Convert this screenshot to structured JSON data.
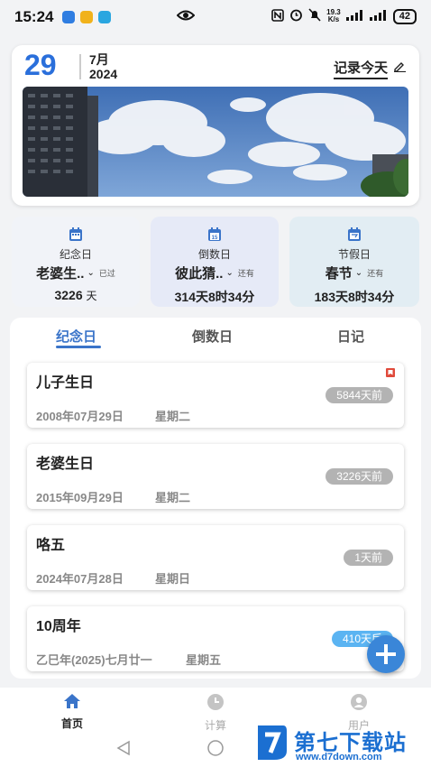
{
  "status_bar": {
    "time": "15:24",
    "net_speed_value": "19.3",
    "net_speed_unit": "K/s",
    "battery": "42"
  },
  "header": {
    "day": "29",
    "month": "7月",
    "year": "2024",
    "record_label": "记录今天"
  },
  "stats": [
    {
      "type": "纪念日",
      "name": "老婆生..",
      "suffix": "已过",
      "value": "3226",
      "unit": "天",
      "value_text": null
    },
    {
      "type": "倒数日",
      "name": "彼此猜..",
      "suffix": "还有",
      "value_text": "314天8时34分"
    },
    {
      "type": "节假日",
      "name": "春节",
      "suffix": "还有",
      "value_text": "183天8时34分"
    }
  ],
  "tabs": [
    "纪念日",
    "倒数日",
    "日记"
  ],
  "events": [
    {
      "title": "儿子生日",
      "date": "2008年07月29日",
      "weekday": "星期二",
      "badge": "5844天前",
      "bookmarked": true
    },
    {
      "title": "老婆生日",
      "date": "2015年09月29日",
      "weekday": "星期二",
      "badge": "3226天前",
      "bookmarked": false
    },
    {
      "title": "咯五",
      "date": "2024年07月28日",
      "weekday": "星期日",
      "badge": "1天前",
      "bookmarked": false
    },
    {
      "title": "10周年",
      "date": "乙巳年(2025)七月廿一",
      "weekday": "星期五",
      "badge": "410天后",
      "bookmarked": false
    }
  ],
  "nav": [
    {
      "label": "首页",
      "icon": "home-icon"
    },
    {
      "label": "计算",
      "icon": "clock-icon"
    },
    {
      "label": "用户",
      "icon": "user-icon"
    }
  ],
  "watermark": {
    "name": "第七下载站",
    "url": "www.d7down.com"
  },
  "colors": {
    "accent": "#3a74c9",
    "day_number": "#2a6fdb",
    "card_anniversary": "#f1f3f8",
    "card_countdown": "#e6eaf7",
    "card_holiday": "#e2edf3",
    "badge_grey": "#b3b3b3",
    "badge_blue": "#5bb4f2"
  }
}
